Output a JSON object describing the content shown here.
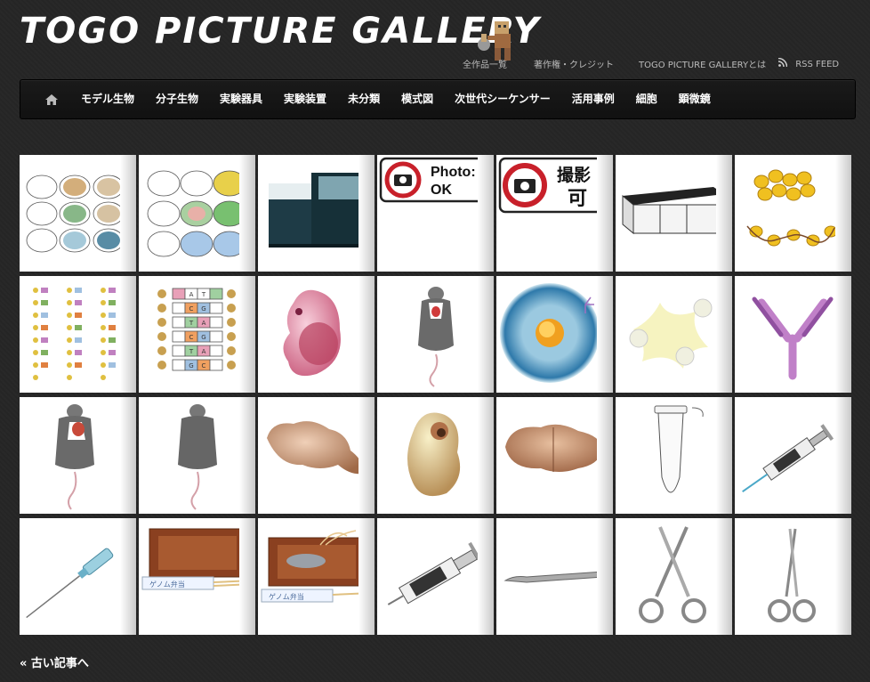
{
  "site": {
    "title": "TOGO PICTURE GALLERY"
  },
  "top_links": [
    {
      "label": "全作品一覧"
    },
    {
      "label": "著作権・クレジット"
    },
    {
      "label": "TOGO PICTURE GALLERYとは"
    },
    {
      "label": "RSS FEED",
      "icon": "rss-icon"
    }
  ],
  "nav": {
    "home_icon": "home-icon",
    "items": [
      {
        "label": "モデル生物"
      },
      {
        "label": "分子生物"
      },
      {
        "label": "実験器具"
      },
      {
        "label": "実験装置"
      },
      {
        "label": "未分類"
      },
      {
        "label": "模式図"
      },
      {
        "label": "次世代シーケンサー"
      },
      {
        "label": "活用事例"
      },
      {
        "label": "細胞"
      },
      {
        "label": "顕微鏡"
      }
    ]
  },
  "gallery": {
    "thumbnails": [
      {
        "icon": "brain-sections-outline-image"
      },
      {
        "icon": "brain-sections-colored-image"
      },
      {
        "icon": "sequencer-machine-image"
      },
      {
        "icon": "photo-ok-sign-image",
        "sign_text": [
          "Photo:",
          "OK"
        ]
      },
      {
        "icon": "photo-allowed-sign-image",
        "sign_text": [
          "撮影",
          "可"
        ]
      },
      {
        "icon": "lab-bench-image"
      },
      {
        "icon": "nucleosome-beads-image"
      },
      {
        "icon": "dna-strands-small-image"
      },
      {
        "icon": "dna-base-pairs-image",
        "bases": [
          "A",
          "T",
          "C",
          "G",
          "T",
          "A",
          "C",
          "G",
          "T",
          "A",
          "G",
          "C"
        ]
      },
      {
        "icon": "mouse-embryo-image"
      },
      {
        "icon": "dissected-mouse-image"
      },
      {
        "icon": "oocyte-cell-image"
      },
      {
        "icon": "neuron-cells-image"
      },
      {
        "icon": "antibody-image"
      },
      {
        "icon": "dissected-mouse-open-image"
      },
      {
        "icon": "mouse-top-view-image"
      },
      {
        "icon": "brain-side-view-image"
      },
      {
        "icon": "chick-embryo-image"
      },
      {
        "icon": "brain-top-view-image"
      },
      {
        "icon": "microtube-image"
      },
      {
        "icon": "syringe-with-needle-image"
      },
      {
        "icon": "injection-needle-image"
      },
      {
        "icon": "bento-box-empty-image",
        "label": "ゲノム弁当"
      },
      {
        "icon": "bento-box-fish-image",
        "label": "ゲノム弁当"
      },
      {
        "icon": "syringe-large-image"
      },
      {
        "icon": "scalpel-image"
      },
      {
        "icon": "scissors-curved-image"
      },
      {
        "icon": "scissors-straight-image"
      }
    ]
  },
  "pagination": {
    "older_label": "« 古い記事へ"
  }
}
